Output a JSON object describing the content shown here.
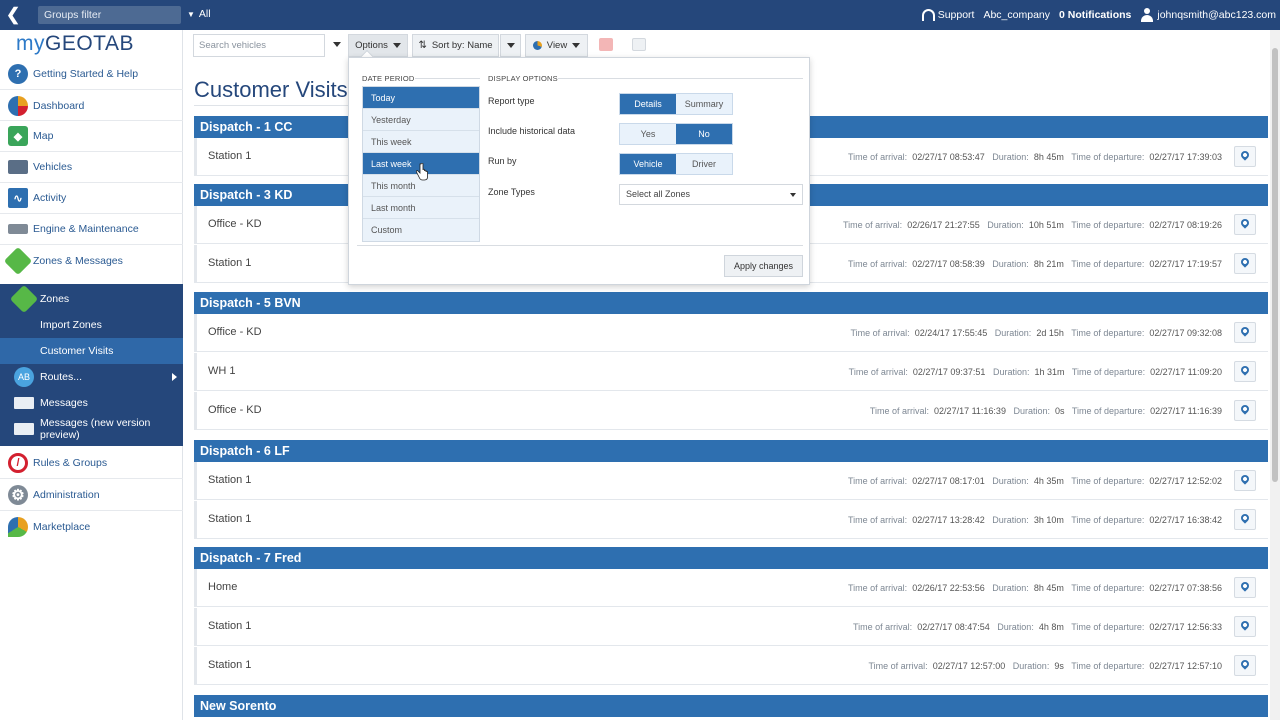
{
  "topbar": {
    "groups_filter": "Groups filter",
    "all_label": "All",
    "support": "Support",
    "company": "Abc_company",
    "notifications": "0 Notifications",
    "user": "johnqsmith@abc123.com"
  },
  "sidebar": {
    "logo_my": "my",
    "logo_geotab": "GEOTAB",
    "items": [
      {
        "label": "Getting Started & Help",
        "icon": "help-icon",
        "color": "#2e6fb0"
      },
      {
        "label": "Dashboard",
        "icon": "pie-chart-icon",
        "color": "#e8a020"
      },
      {
        "label": "Map",
        "icon": "map-icon",
        "color": "#3aa55a"
      },
      {
        "label": "Vehicles",
        "icon": "truck-icon",
        "color": "#5a6e86"
      },
      {
        "label": "Activity",
        "icon": "activity-chart-icon",
        "color": "#2e6fb0"
      },
      {
        "label": "Engine & Maintenance",
        "icon": "engine-icon",
        "color": "#7f8a96"
      },
      {
        "label": "Zones & Messages",
        "icon": "zones-icon",
        "color": "#57b847"
      }
    ],
    "sub_items": [
      {
        "label": "Zones",
        "icon": "zones-icon"
      },
      {
        "label": "Import Zones"
      },
      {
        "label": "Customer Visits"
      },
      {
        "label": "Routes...",
        "icon": "route-icon"
      },
      {
        "label": "Messages",
        "icon": "message-icon"
      },
      {
        "label": "Messages (new version preview)",
        "icon": "message-icon"
      }
    ],
    "bottom_items": [
      {
        "label": "Rules & Groups",
        "icon": "no-entry-icon",
        "color": "#d3202f"
      },
      {
        "label": "Administration",
        "icon": "gear-icon",
        "color": "#7f8a96"
      },
      {
        "label": "Marketplace",
        "icon": "marketplace-pin-icon",
        "color": "#e8a020"
      }
    ]
  },
  "toolbar": {
    "search_placeholder": "Search vehicles",
    "options": "Options",
    "sort": "Sort by: Name",
    "view": "View"
  },
  "page": {
    "title": "Customer Visits"
  },
  "labels": {
    "arrival": "Time of arrival:",
    "duration": "Duration:",
    "departure": "Time of departure:"
  },
  "groups": [
    {
      "name": "Dispatch - 1 CC",
      "rows": [
        {
          "zone": "Station 1",
          "arrival": "02/27/17 08:53:47",
          "duration": "8h 45m",
          "departure": "02/27/17 17:39:03"
        }
      ]
    },
    {
      "name": "Dispatch - 3 KD",
      "rows": [
        {
          "zone": "Office - KD",
          "arrival": "02/26/17 21:27:55",
          "duration": "10h 51m",
          "departure": "02/27/17 08:19:26"
        },
        {
          "zone": "Station 1",
          "arrival": "02/27/17 08:58:39",
          "duration": "8h 21m",
          "departure": "02/27/17 17:19:57"
        }
      ]
    },
    {
      "name": "Dispatch - 5 BVN",
      "rows": [
        {
          "zone": "Office - KD",
          "arrival": "02/24/17 17:55:45",
          "duration": "2d 15h",
          "departure": "02/27/17 09:32:08"
        },
        {
          "zone": "WH 1",
          "arrival": "02/27/17 09:37:51",
          "duration": "1h 31m",
          "departure": "02/27/17 11:09:20"
        },
        {
          "zone": "Office - KD",
          "arrival": "02/27/17 11:16:39",
          "duration": "0s",
          "departure": "02/27/17 11:16:39"
        }
      ]
    },
    {
      "name": "Dispatch - 6 LF",
      "rows": [
        {
          "zone": "Station 1",
          "arrival": "02/27/17 08:17:01",
          "duration": "4h 35m",
          "departure": "02/27/17 12:52:02"
        },
        {
          "zone": "Station 1",
          "arrival": "02/27/17 13:28:42",
          "duration": "3h 10m",
          "departure": "02/27/17 16:38:42"
        }
      ]
    },
    {
      "name": "Dispatch - 7 Fred",
      "rows": [
        {
          "zone": "Home",
          "arrival": "02/26/17 22:53:56",
          "duration": "8h 45m",
          "departure": "02/27/17 07:38:56"
        },
        {
          "zone": "Station 1",
          "arrival": "02/27/17 08:47:54",
          "duration": "4h 8m",
          "departure": "02/27/17 12:56:33"
        },
        {
          "zone": "Station 1",
          "arrival": "02/27/17 12:57:00",
          "duration": "9s",
          "departure": "02/27/17 12:57:10"
        }
      ]
    },
    {
      "name": "New Sorento",
      "rows": []
    }
  ],
  "popup": {
    "date_period_label": "DATE PERIOD",
    "display_options_label": "DISPLAY OPTIONS",
    "periods": [
      "Today",
      "Yesterday",
      "This week",
      "Last week",
      "This month",
      "Last month",
      "Custom"
    ],
    "selected_periods": [
      "Today",
      "Last week"
    ],
    "report_type_label": "Report type",
    "report_type_options": [
      "Details",
      "Summary"
    ],
    "report_type_selected": "Details",
    "historical_label": "Include historical data",
    "historical_options": [
      "Yes",
      "No"
    ],
    "historical_selected": "No",
    "run_by_label": "Run by",
    "run_by_options": [
      "Vehicle",
      "Driver"
    ],
    "run_by_selected": "Vehicle",
    "zone_types_label": "Zone Types",
    "zone_types_value": "Select all Zones",
    "apply": "Apply changes"
  }
}
